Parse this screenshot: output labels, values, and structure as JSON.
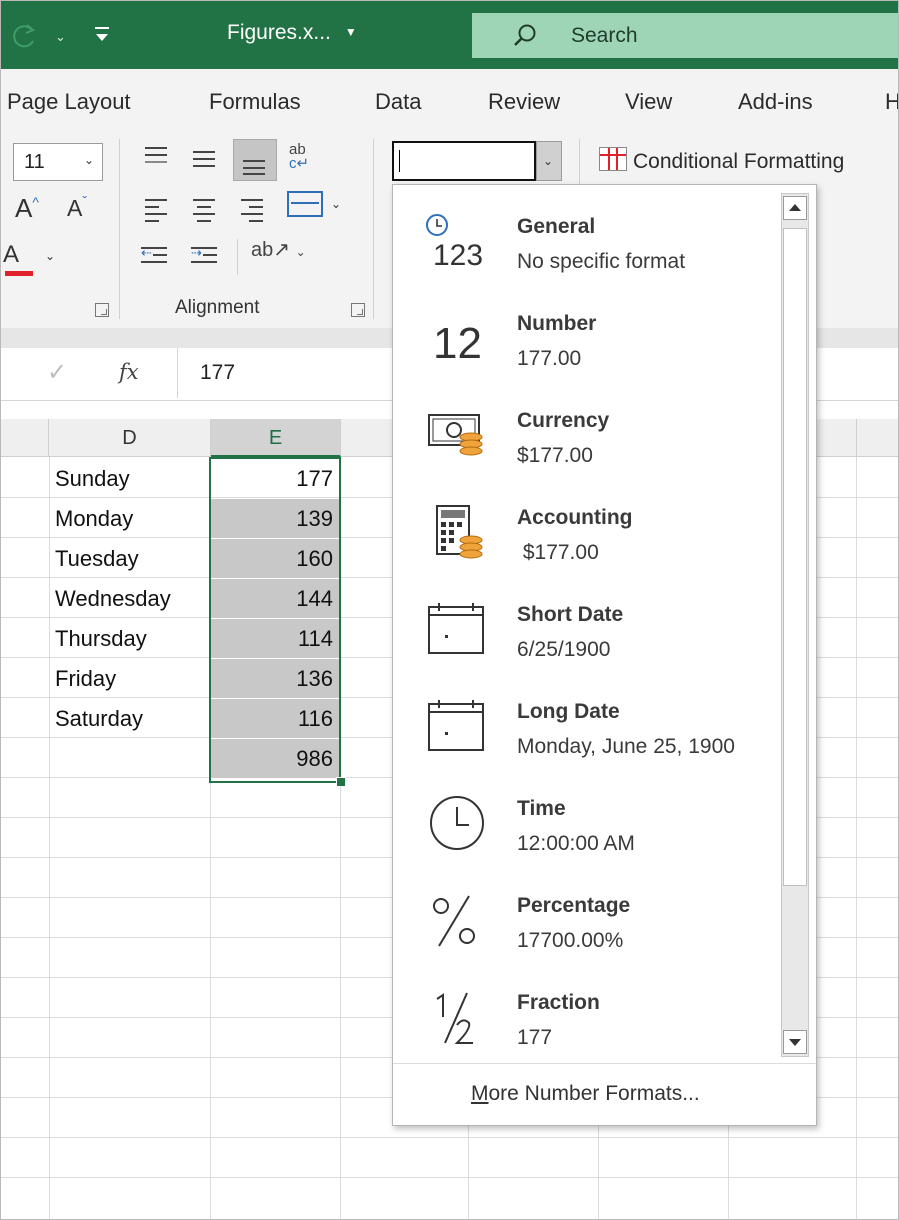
{
  "title_bar": {
    "file_name": "Figures.x...",
    "search_placeholder": "Search"
  },
  "tabs": [
    "Page Layout",
    "Formulas",
    "Data",
    "Review",
    "View",
    "Add-ins",
    "H"
  ],
  "ribbon": {
    "font_size": "11",
    "font_color_glyph": "A",
    "alignment_group_label": "Alignment",
    "number_format_value": "",
    "conditional_formatting_label": "Conditional Formatting"
  },
  "formula_bar": {
    "fx_label": "fx",
    "value": "177"
  },
  "sheet": {
    "columns": [
      "D",
      "E"
    ],
    "rows": [
      {
        "d": "Sunday",
        "e": "177"
      },
      {
        "d": "Monday",
        "e": "139"
      },
      {
        "d": "Tuesday",
        "e": "160"
      },
      {
        "d": "Wednesday",
        "e": "144"
      },
      {
        "d": "Thursday",
        "e": "114"
      },
      {
        "d": "Friday",
        "e": "136"
      },
      {
        "d": "Saturday",
        "e": "116"
      },
      {
        "d": "",
        "e": "986"
      }
    ]
  },
  "number_format_menu": {
    "items": [
      {
        "name": "General",
        "example": "No specific format",
        "icon": "general-icon",
        "icon_text": "123"
      },
      {
        "name": "Number",
        "example": "177.00",
        "icon": "number-icon",
        "icon_text": "12"
      },
      {
        "name": "Currency",
        "example": "$177.00",
        "icon": "currency-icon"
      },
      {
        "name": "Accounting",
        "example": " $177.00",
        "icon": "accounting-icon"
      },
      {
        "name": "Short Date",
        "example": "6/25/1900",
        "icon": "calendar-icon"
      },
      {
        "name": "Long Date",
        "example": "Monday, June 25, 1900",
        "icon": "calendar-icon"
      },
      {
        "name": "Time",
        "example": "12:00:00 AM",
        "icon": "clock-icon"
      },
      {
        "name": "Percentage",
        "example": "17700.00%",
        "icon": "percent-icon"
      },
      {
        "name": "Fraction",
        "example": "177",
        "icon": "fraction-icon"
      }
    ],
    "more_label_underlined": "M",
    "more_label_rest": "ore Number Formats..."
  },
  "colors": {
    "excel_green": "#217346",
    "search_bg": "#9fd5b7",
    "selection_fill": "#c8c8c8"
  }
}
